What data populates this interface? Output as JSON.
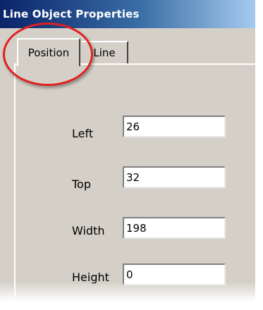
{
  "window": {
    "title": "Line Object Properties"
  },
  "tabs": [
    {
      "label": "Position",
      "selected": true
    },
    {
      "label": "Line",
      "selected": false
    }
  ],
  "fields": {
    "left": {
      "label": "Left",
      "value": "26"
    },
    "top": {
      "label": "Top",
      "value": "32"
    },
    "width": {
      "label": "Width",
      "value": "198"
    },
    "height": {
      "label": "Height",
      "value": "0"
    }
  },
  "annotation": {
    "color": "#e02020",
    "target": "Position tab"
  },
  "colors": {
    "face": "#d4d0c8",
    "title_start": "#0a246a",
    "title_end": "#a6caf0"
  }
}
